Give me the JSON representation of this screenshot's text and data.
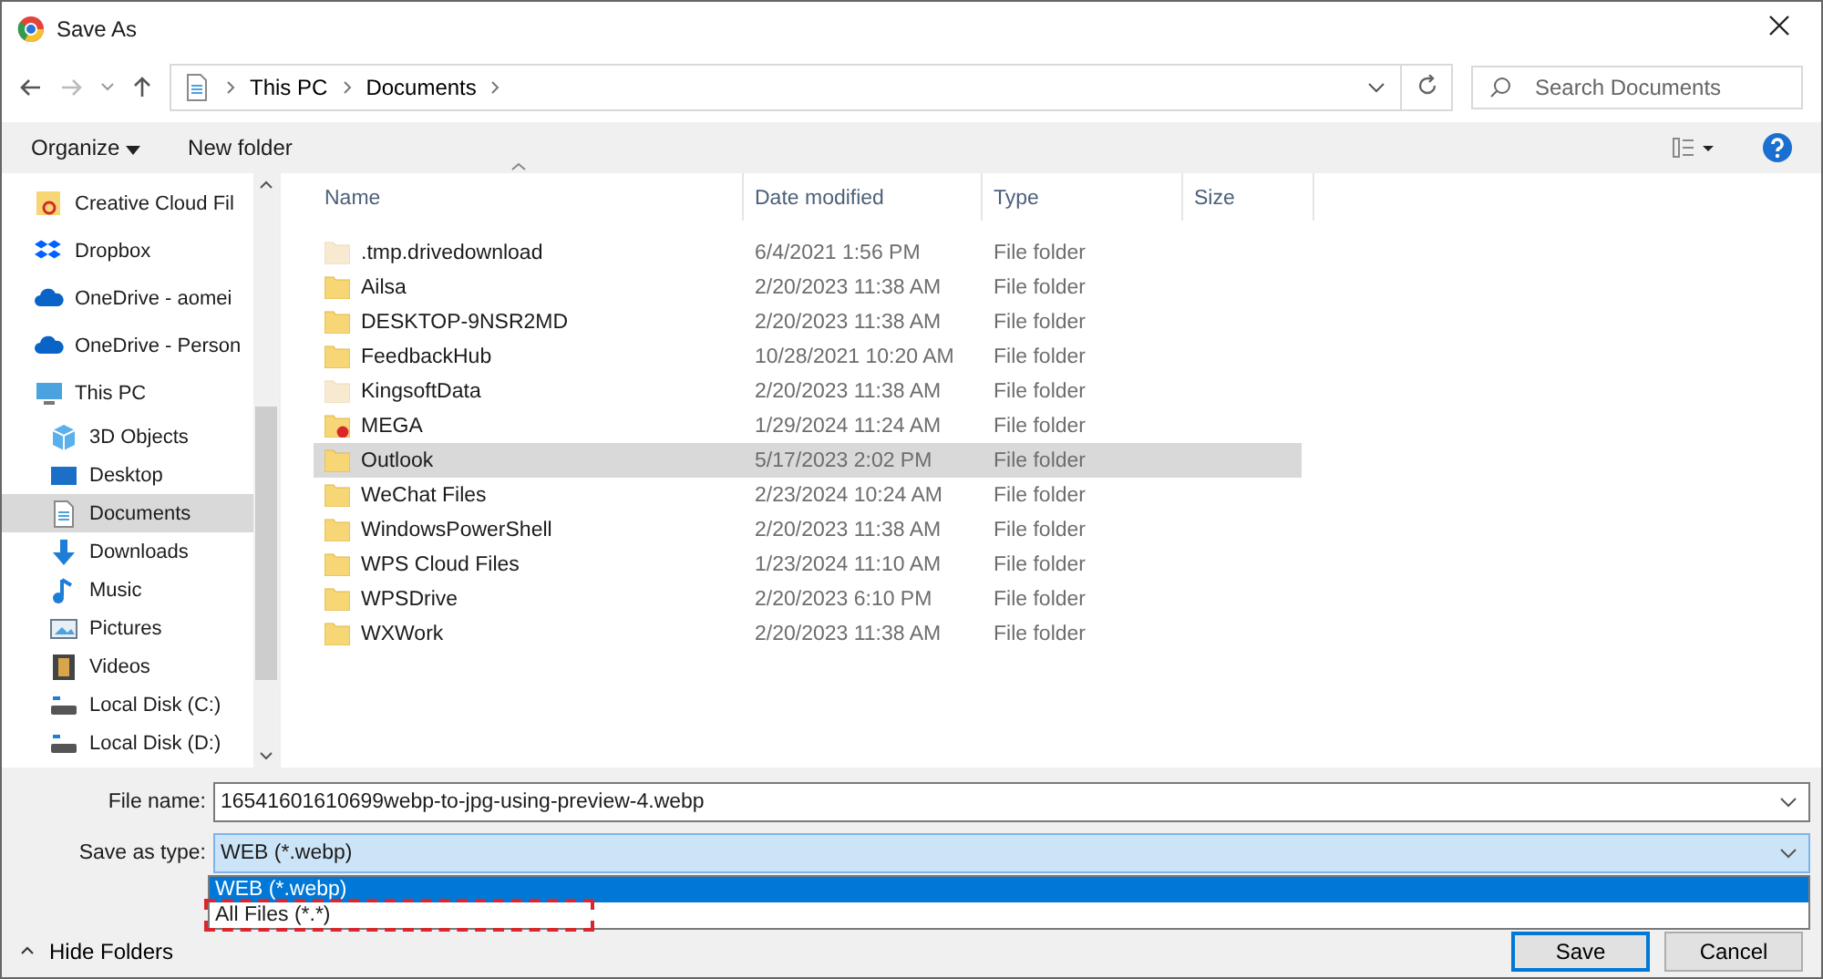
{
  "window": {
    "title": "Save As"
  },
  "address": {
    "crumbs": [
      "This PC",
      "Documents"
    ]
  },
  "search": {
    "placeholder": "Search Documents"
  },
  "toolbar": {
    "organize": "Organize",
    "new_folder": "New folder"
  },
  "sidebar": {
    "items": [
      {
        "label": "Creative Cloud Fil",
        "kind": "cloud-files",
        "selected": false
      },
      {
        "label": "Dropbox",
        "kind": "dropbox",
        "selected": false
      },
      {
        "label": "OneDrive - aomei",
        "kind": "onedrive",
        "selected": false
      },
      {
        "label": "OneDrive - Person",
        "kind": "onedrive",
        "selected": false
      },
      {
        "label": "This PC",
        "kind": "pc",
        "selected": false,
        "children": [
          {
            "label": "3D Objects",
            "kind": "cube",
            "selected": false
          },
          {
            "label": "Desktop",
            "kind": "desktop",
            "selected": false
          },
          {
            "label": "Documents",
            "kind": "document",
            "selected": true
          },
          {
            "label": "Downloads",
            "kind": "download",
            "selected": false
          },
          {
            "label": "Music",
            "kind": "music",
            "selected": false
          },
          {
            "label": "Pictures",
            "kind": "picture",
            "selected": false
          },
          {
            "label": "Videos",
            "kind": "video",
            "selected": false
          },
          {
            "label": "Local Disk (C:)",
            "kind": "disk",
            "selected": false
          },
          {
            "label": "Local Disk (D:)",
            "kind": "disk",
            "selected": false
          }
        ]
      }
    ]
  },
  "table": {
    "columns": [
      "Name",
      "Date modified",
      "Type",
      "Size"
    ],
    "rows": [
      {
        "name": ".tmp.drivedownload",
        "date": "6/4/2021 1:56 PM",
        "type": "File folder",
        "kind": "hidden",
        "selected": false
      },
      {
        "name": "Ailsa",
        "date": "2/20/2023 11:38 AM",
        "type": "File folder",
        "kind": "folder",
        "selected": false
      },
      {
        "name": "DESKTOP-9NSR2MD",
        "date": "2/20/2023 11:38 AM",
        "type": "File folder",
        "kind": "folder",
        "selected": false
      },
      {
        "name": "FeedbackHub",
        "date": "10/28/2021 10:20 AM",
        "type": "File folder",
        "kind": "folder",
        "selected": false
      },
      {
        "name": "KingsoftData",
        "date": "2/20/2023 11:38 AM",
        "type": "File folder",
        "kind": "hidden",
        "selected": false
      },
      {
        "name": "MEGA",
        "date": "1/29/2024 11:24 AM",
        "type": "File folder",
        "kind": "badged",
        "selected": false
      },
      {
        "name": "Outlook",
        "date": "5/17/2023 2:02 PM",
        "type": "File folder",
        "kind": "folder",
        "selected": true
      },
      {
        "name": "WeChat Files",
        "date": "2/23/2024 10:24 AM",
        "type": "File folder",
        "kind": "folder",
        "selected": false
      },
      {
        "name": "WindowsPowerShell",
        "date": "2/20/2023 11:38 AM",
        "type": "File folder",
        "kind": "folder",
        "selected": false
      },
      {
        "name": "WPS Cloud Files",
        "date": "1/23/2024 11:10 AM",
        "type": "File folder",
        "kind": "folder",
        "selected": false
      },
      {
        "name": "WPSDrive",
        "date": "2/20/2023 6:10 PM",
        "type": "File folder",
        "kind": "folder",
        "selected": false
      },
      {
        "name": "WXWork",
        "date": "2/20/2023 11:38 AM",
        "type": "File folder",
        "kind": "folder",
        "selected": false
      }
    ]
  },
  "form": {
    "file_name_label": "File name:",
    "file_name": "16541601610699webp-to-jpg-using-preview-4.webp",
    "type_label": "Save as type:",
    "type_value": "WEB (*.webp)",
    "type_options": [
      {
        "label": "WEB (*.webp)",
        "selected": true,
        "highlighted": false
      },
      {
        "label": "All Files (*.*)",
        "selected": false,
        "highlighted": true
      }
    ]
  },
  "footer": {
    "hide_folders": "Hide Folders",
    "buttons": [
      "Save",
      "Cancel"
    ]
  }
}
